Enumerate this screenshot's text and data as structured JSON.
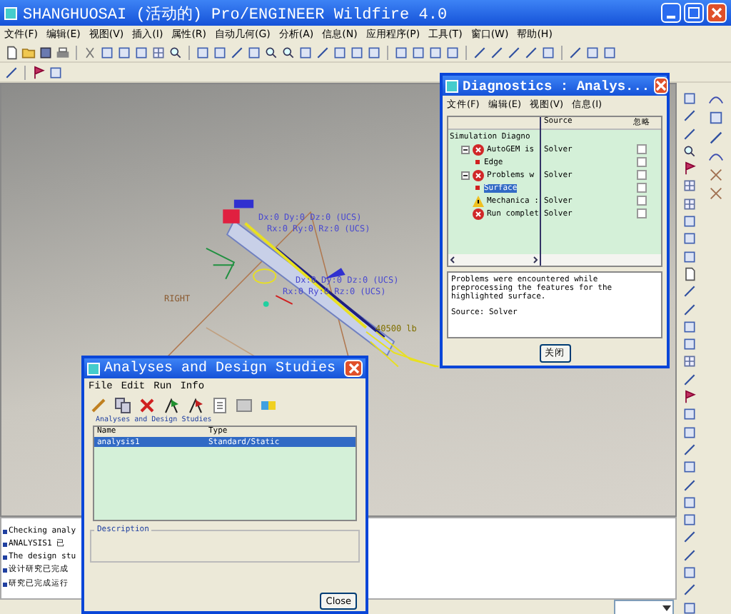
{
  "window": {
    "title": "SHANGHUOSAI (活动的)    Pro/ENGINEER Wildfire 4.0"
  },
  "menu": [
    "文件(F)",
    "编辑(E)",
    "视图(V)",
    "插入(I)",
    "属性(R)",
    "自动几何(G)",
    "分析(A)",
    "信息(N)",
    "应用程序(P)",
    "工具(T)",
    "窗口(W)",
    "帮助(H)"
  ],
  "model_labels": [
    {
      "text": "Dx:0 Dy:0 Dz:0 (UCS)",
      "kind": "constraint"
    },
    {
      "text": "Rx:0 Ry:0 Rz:0 (UCS)",
      "kind": "constraint"
    },
    {
      "text": "Dx:0 Dy:0 Dz:0 (UCS)",
      "kind": "constraint"
    },
    {
      "text": "Rx:0 Ry:0 Rz:0 (UCS)",
      "kind": "constraint"
    },
    {
      "text": "RIGHT",
      "kind": "datum"
    },
    {
      "text": "40500 lb",
      "kind": "load"
    }
  ],
  "messages": [
    "Checking analy",
    "ANALYSIS1 已",
    "The design stu",
    "设计研究已完成",
    "研究已完成运行"
  ],
  "diagnostics": {
    "title": "Diagnostics : Analys...",
    "menu": [
      "文件(F)",
      "编辑(E)",
      "视图(V)",
      "信息(I)"
    ],
    "columns": [
      "Source",
      "忽略"
    ],
    "tree": {
      "label": "Simulation Diagno",
      "children": [
        {
          "label": "AutoGEM is",
          "kind": "error",
          "source": "Solver",
          "checked": false,
          "selected": false,
          "expanded": true,
          "children": [
            {
              "label": "Edge",
              "checked": false,
              "selected": false
            }
          ]
        },
        {
          "label": "Problems w",
          "kind": "error",
          "source": "Solver",
          "checked": false,
          "selected": false,
          "expanded": true,
          "children": [
            {
              "label": "Surface",
              "checked": false,
              "selected": true
            }
          ]
        },
        {
          "label": "Mechanica :",
          "kind": "warning",
          "source": "Solver",
          "checked": false,
          "selected": false
        },
        {
          "label": "Run complet",
          "kind": "error",
          "source": "Solver",
          "checked": false,
          "selected": false
        }
      ]
    },
    "description": "Problems were encountered while preprocessing the features for the highlighted surface.",
    "source_line": "Source: Solver",
    "close_button": "关闭"
  },
  "analyses": {
    "title": "Analyses and Design Studies",
    "menu": [
      "File",
      "Edit",
      "Run",
      "Info"
    ],
    "list_caption": "Analyses and Design Studies",
    "columns": [
      "Name",
      "Type"
    ],
    "rows": [
      {
        "name": "analysis1",
        "type": "Standard/Static",
        "selected": true
      }
    ],
    "description_label": "Description",
    "close_button": "Close"
  }
}
